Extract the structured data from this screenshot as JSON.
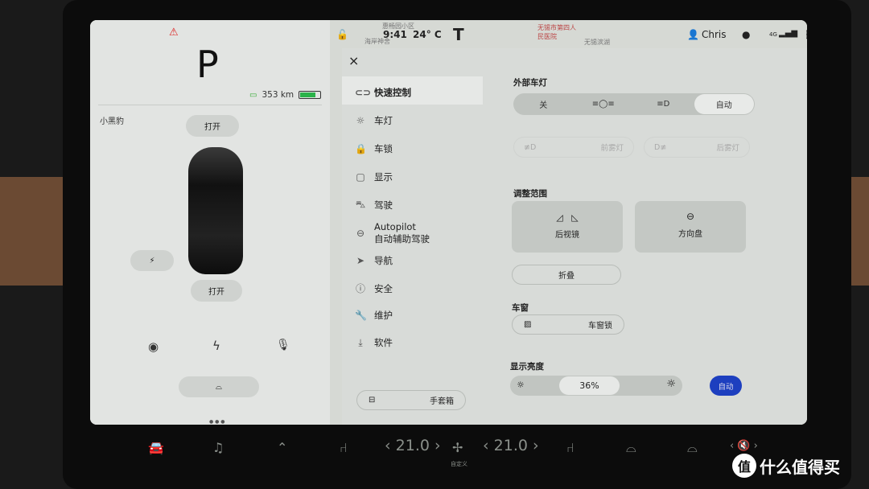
{
  "status": {
    "time": "9:41",
    "temperature": "24° C",
    "user": "Chris",
    "network": "4G",
    "map_labels": [
      "海岸神舍",
      "惠畅园小区",
      "无锡市第四人民医院",
      "无锡滨湖"
    ]
  },
  "left": {
    "gear": "P",
    "range": "353 km",
    "battery_level": 0.8,
    "car_name": "小黑豹",
    "frunk_label": "打开",
    "trunk_label": "打开"
  },
  "menu": {
    "close": "×",
    "items": [
      {
        "icon": "toggle-icon",
        "label": "快速控制"
      },
      {
        "icon": "light-icon",
        "label": "车灯"
      },
      {
        "icon": "lock-icon",
        "label": "车锁"
      },
      {
        "icon": "display-icon",
        "label": "显示"
      },
      {
        "icon": "car-icon",
        "label": "驾驶"
      },
      {
        "icon": "steering-wheel-icon",
        "label": "Autopilot",
        "sub": "自动辅助驾驶"
      },
      {
        "icon": "navigation-icon",
        "label": "导航"
      },
      {
        "icon": "safety-icon",
        "label": "安全"
      },
      {
        "icon": "wrench-icon",
        "label": "维护"
      },
      {
        "icon": "download-icon",
        "label": "软件"
      }
    ],
    "glovebox": "手套箱"
  },
  "content": {
    "lights_title": "外部车灯",
    "lights_options": [
      "关",
      "",
      "",
      "自动"
    ],
    "lights_selected": "自动",
    "front_fog": "前雾灯",
    "rear_fog": "后雾灯",
    "adjust_title": "调整范围",
    "mirrors": "后视镜",
    "steering": "方向盘",
    "fold": "折叠",
    "window_title": "车窗",
    "window_lock": "车窗锁",
    "brightness_title": "显示亮度",
    "brightness": "36%",
    "brightness_value": 36,
    "auto": "自动",
    "accent": "#1d3fbf"
  },
  "climate": {
    "left_temp": "21.0",
    "right_temp": "21.0",
    "fan_label": "自定义"
  },
  "watermark": "什么值得买"
}
